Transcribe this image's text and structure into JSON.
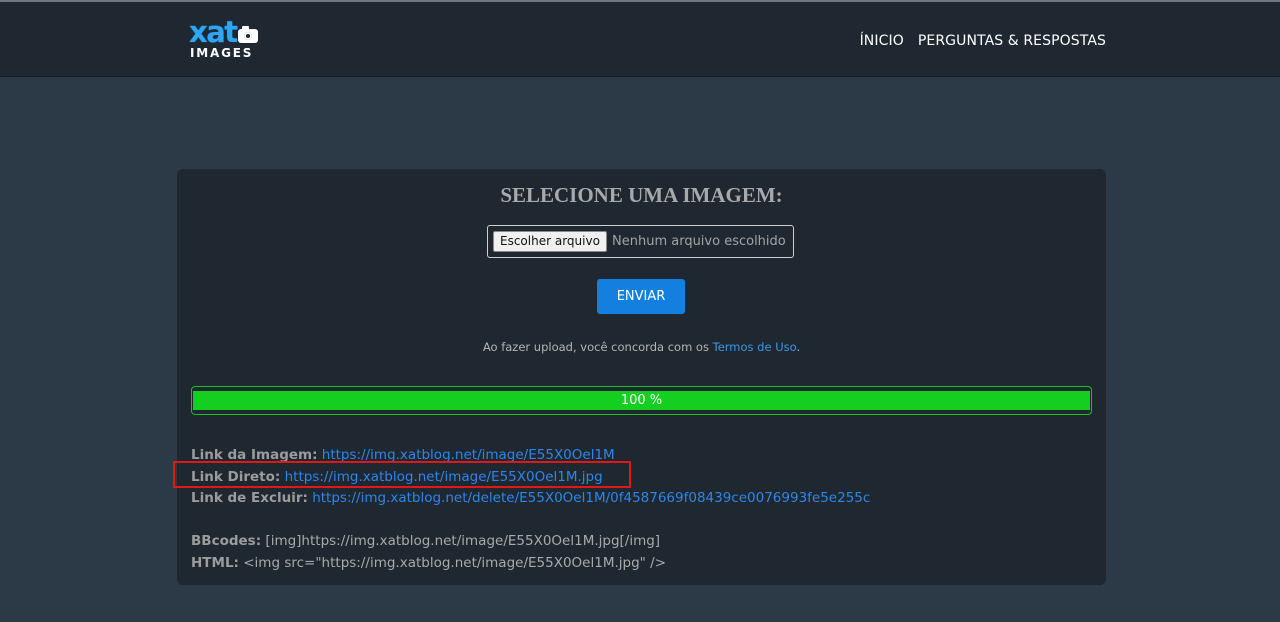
{
  "header": {
    "logo": {
      "word": "xat",
      "subword": "IMAGES",
      "icon": "camera-icon"
    },
    "nav": [
      {
        "label": "ÍNICIO"
      },
      {
        "label": "PERGUNTAS & RESPOSTAS"
      }
    ]
  },
  "upload": {
    "title": "SELECIONE UMA IMAGEM:",
    "file_button": "Escolher arquivo",
    "file_status": "Nenhum arquivo escolhido",
    "submit_label": "ENVIAR",
    "terms_prefix": "Ao fazer upload, você concorda com os ",
    "terms_link": "Termos de Uso",
    "terms_suffix": "."
  },
  "progress": {
    "percent": 100,
    "label": "100 %"
  },
  "results": {
    "image_link": {
      "label": "Link da Imagem:",
      "value": "https://img.xatblog.net/image/E55X0Oel1M"
    },
    "direct_link": {
      "label": "Link Direto:",
      "value": "https://img.xatblog.net/image/E55X0Oel1M.jpg"
    },
    "delete_link": {
      "label": "Link de Excluir:",
      "value": "https://img.xatblog.net/delete/E55X0Oel1M/0f4587669f08439ce0076993fe5e255c"
    },
    "bbcode": {
      "label": "BBcodes:",
      "value": "[img]https://img.xatblog.net/image/E55X0Oel1M.jpg[/img]"
    },
    "html": {
      "label": "HTML:",
      "value": "<img src=\"https://img.xatblog.net/image/E55X0Oel1M.jpg\" />"
    }
  },
  "colors": {
    "background": "#2c3946",
    "panel": "#1f2831",
    "accent": "#1380e0",
    "progress": "#14cf1f",
    "highlight": "#e01818"
  }
}
